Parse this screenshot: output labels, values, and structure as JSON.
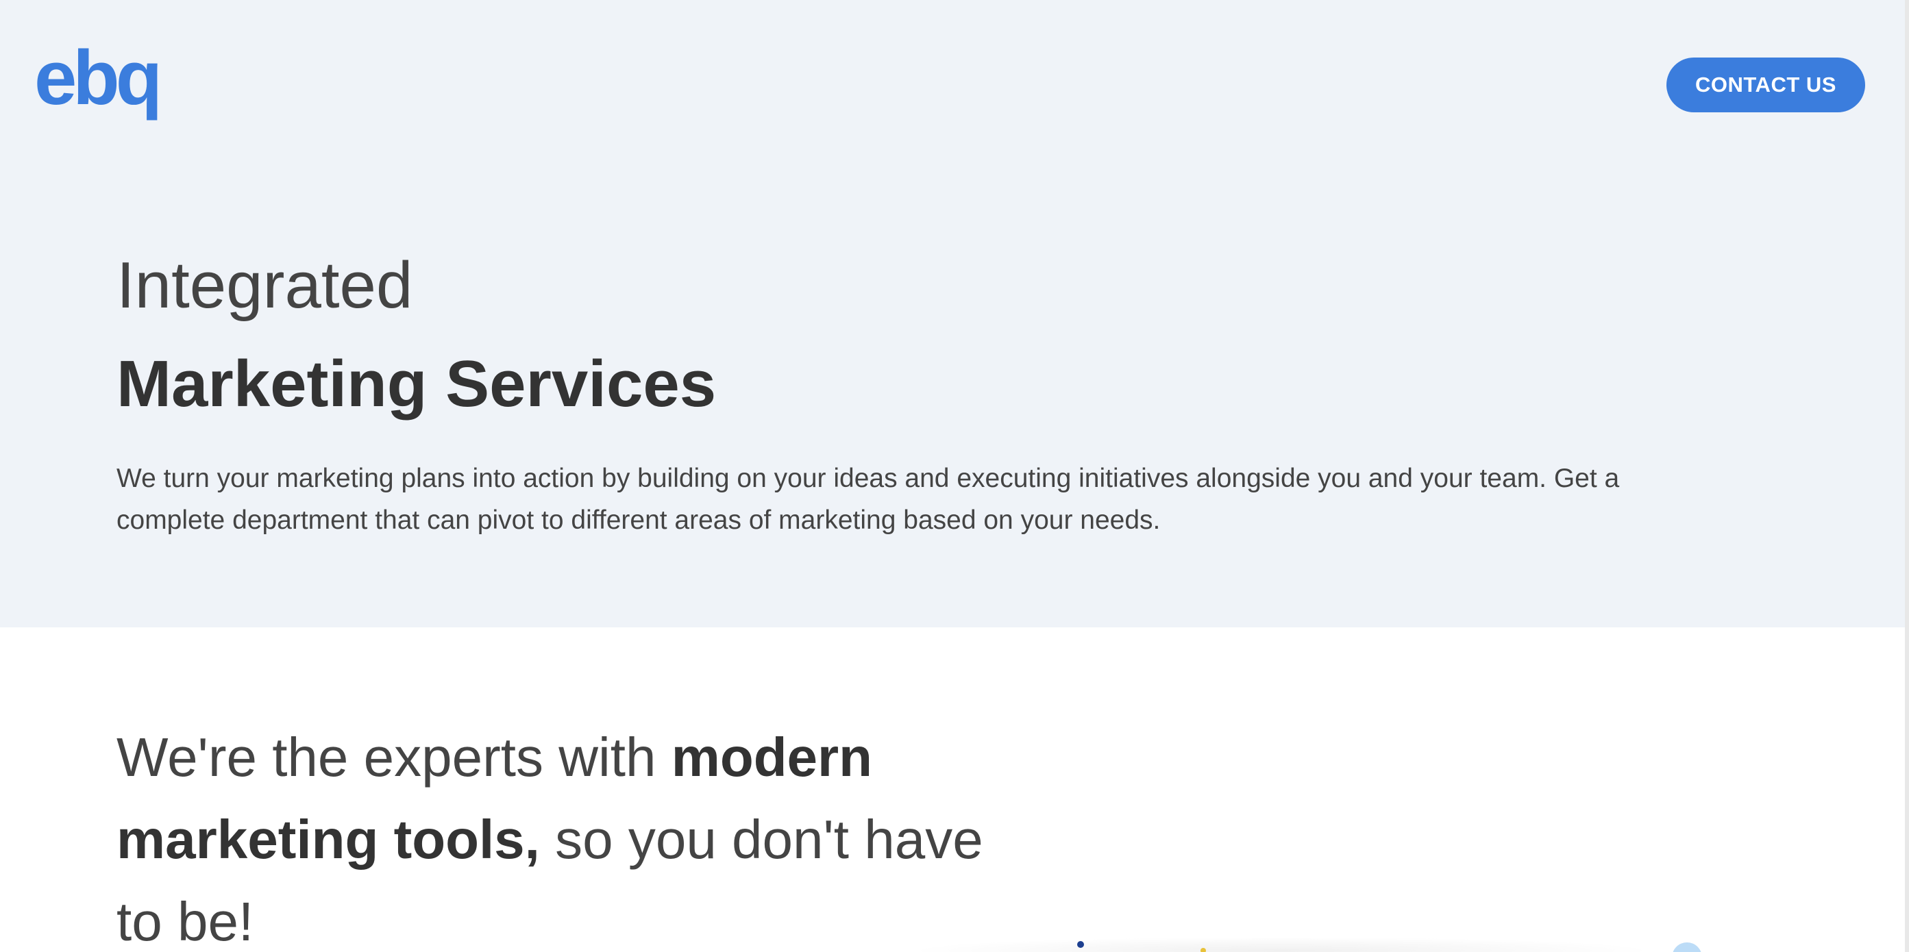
{
  "brand": {
    "logo_text": "ebq",
    "logo_color": "#3b7ddd"
  },
  "header": {
    "contact_label": "CONTACT US"
  },
  "hero": {
    "title_light": "Integrated",
    "title_bold": "Marketing Services",
    "description": "We turn your marketing plans into action by building on your ideas and executing initiatives alongside you and your team. Get a complete department that can pivot to different areas of marketing based on your needs.",
    "background": "#eff3f8"
  },
  "section_experts": {
    "heading_part1": "We're the experts with ",
    "heading_bold": "modern marketing tools,",
    "heading_part2": " so you don't have to be!"
  },
  "colors": {
    "accent": "#3b7ddd",
    "text_dark": "#333333",
    "text_body": "#444444"
  }
}
